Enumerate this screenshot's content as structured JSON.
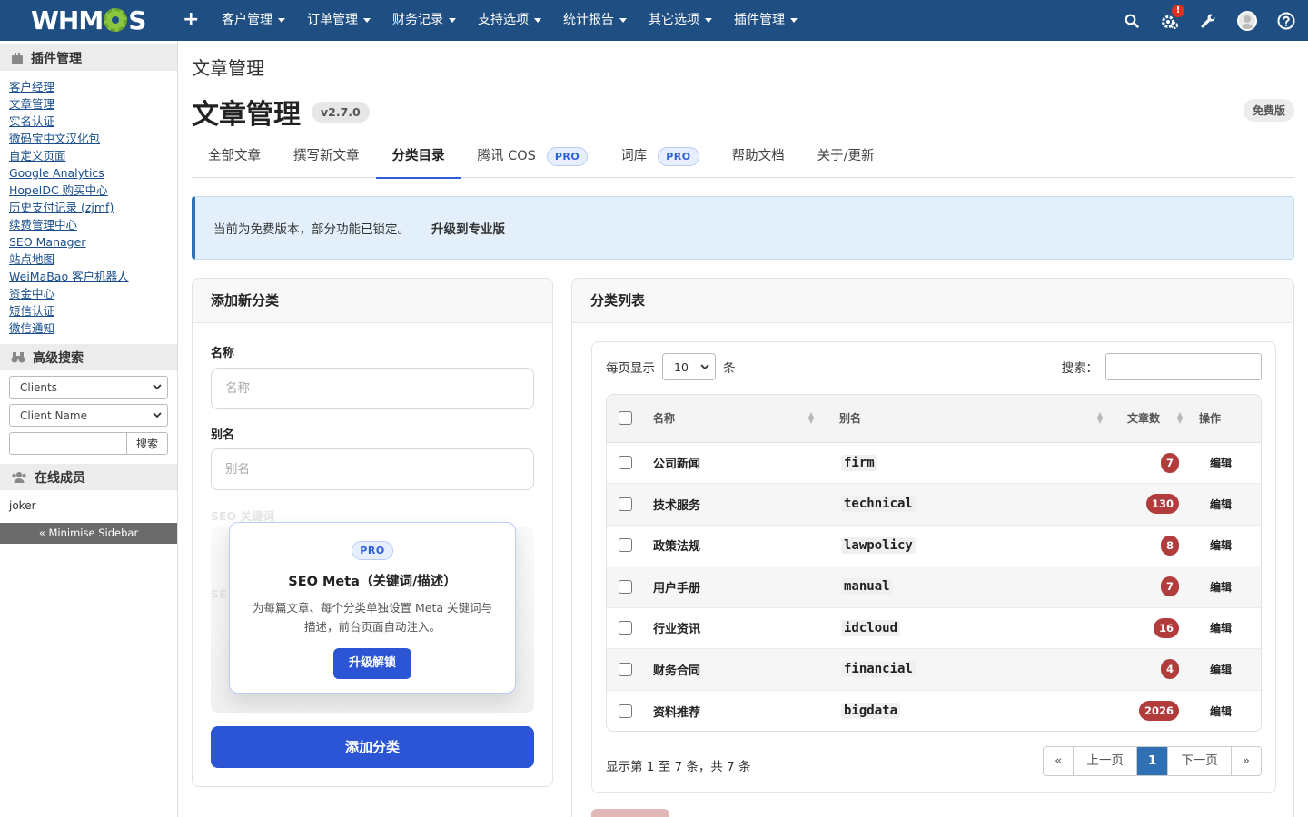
{
  "brand": {
    "logo_text_a": "WHM",
    "logo_text_b": "S"
  },
  "topnav": {
    "plus": "+",
    "items": [
      "客户管理",
      "订单管理",
      "财务记录",
      "支持选项",
      "统计报告",
      "其它选项",
      "插件管理"
    ],
    "notification_badge": "!"
  },
  "sidebar": {
    "addons_title": "插件管理",
    "addon_links": [
      "客户经理",
      "文章管理",
      "实名认证",
      "微码宝中文汉化包",
      "自定义页面",
      "Google Analytics",
      "HopeIDC 购买中心",
      "历史支付记录 (zjmf)",
      "续费管理中心",
      "SEO Manager",
      "站点地图",
      "WeiMaBao 客户机器人",
      "资金中心",
      "短信认证",
      "微信通知"
    ],
    "search_title": "高级搜索",
    "search_type": "Clients",
    "search_field": "Client Name",
    "search_button": "搜索",
    "online_title": "在线成员",
    "online_user": "joker",
    "minimise": "« Minimise Sidebar"
  },
  "page": {
    "breadcrumb": "文章管理",
    "title": "文章管理",
    "version": "v2.7.0",
    "edition": "免费版",
    "tabs": [
      {
        "label": "全部文章",
        "pro": ""
      },
      {
        "label": "撰写新文章",
        "pro": ""
      },
      {
        "label": "分类目录",
        "pro": ""
      },
      {
        "label": "腾讯 COS",
        "pro": "PRO"
      },
      {
        "label": "词库",
        "pro": "PRO"
      },
      {
        "label": "帮助文档",
        "pro": ""
      },
      {
        "label": "关于/更新",
        "pro": ""
      }
    ],
    "alert_text": "当前为免费版本，部分功能已锁定。",
    "alert_link": "升级到专业版"
  },
  "add_form": {
    "title": "添加新分类",
    "name_label": "名称",
    "name_placeholder": "名称",
    "slug_label": "别名",
    "slug_placeholder": "别名",
    "ghost_label_1": "SEO 关键词",
    "ghost_label_2": "SE",
    "pro_badge": "PRO",
    "popup_title": "SEO Meta（关键词/描述）",
    "popup_desc": "为每篇文章、每个分类单独设置 Meta 关键词与描述，前台页面自动注入。",
    "popup_button": "升级解锁",
    "submit": "添加分类"
  },
  "list": {
    "title": "分类列表",
    "length_prefix": "每页显示",
    "length_value": "10",
    "length_suffix": "条",
    "search_label": "搜索：",
    "columns": [
      "名称",
      "别名",
      "文章数",
      "操作"
    ],
    "rows": [
      {
        "name": "公司新闻",
        "slug": "firm",
        "count": "7",
        "action": "编辑"
      },
      {
        "name": "技术服务",
        "slug": "technical",
        "count": "130",
        "action": "编辑"
      },
      {
        "name": "政策法规",
        "slug": "lawpolicy",
        "count": "8",
        "action": "编辑"
      },
      {
        "name": "用户手册",
        "slug": "manual",
        "count": "7",
        "action": "编辑"
      },
      {
        "name": "行业资讯",
        "slug": "idcloud",
        "count": "16",
        "action": "编辑"
      },
      {
        "name": "财务合同",
        "slug": "financial",
        "count": "4",
        "action": "编辑"
      },
      {
        "name": "资料推荐",
        "slug": "bigdata",
        "count": "2026",
        "action": "编辑"
      }
    ],
    "info": "显示第 1 至 7 条，共 7 条",
    "pager": {
      "first": "«",
      "prev": "上一页",
      "current": "1",
      "next": "下一页",
      "last": "»"
    }
  },
  "colors": {
    "topbar": "#1f4f82",
    "primary": "#2b55d4",
    "badge": "#b23b3b",
    "logo_gear": "#8cc63f"
  }
}
